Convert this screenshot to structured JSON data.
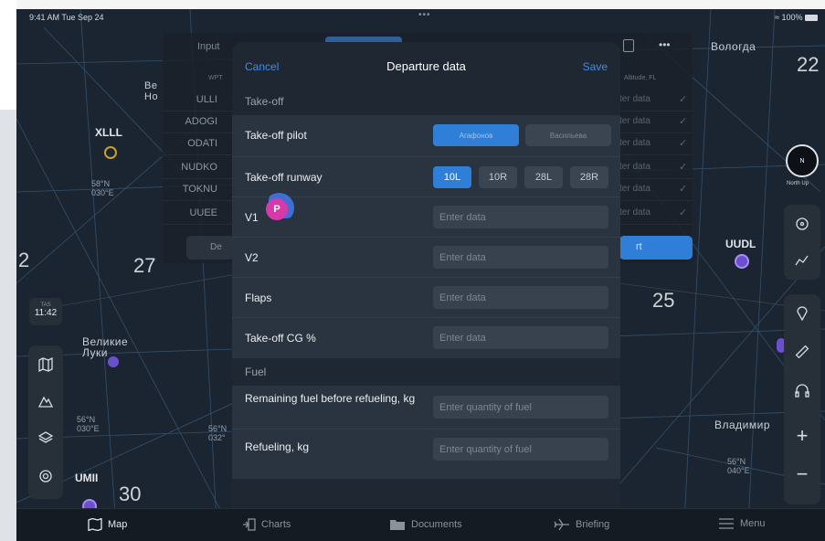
{
  "status_bar": {
    "time": "9:41 AM   Tue Sep 24",
    "battery": "100%",
    "dots": "•••"
  },
  "map": {
    "labels": [
      {
        "text": "Вологда"
      },
      {
        "text": "Великие Луки"
      },
      {
        "text": "Владимир"
      },
      {
        "text": "Be Но"
      }
    ],
    "codes": [
      "XLLL",
      "UUDL",
      "UMII"
    ],
    "coords": [
      {
        "text": "58°N 030°E"
      },
      {
        "text": "56°N 030°E"
      },
      {
        "text": "56°N 032°"
      },
      {
        "text": "56°N 040°E"
      }
    ],
    "big": [
      "27",
      "25",
      "30",
      "22",
      "2"
    ],
    "tas": {
      "label": "TAS",
      "value": "11:42"
    },
    "north_up": "North Up"
  },
  "bg_table": {
    "tab_input": "Input",
    "col_wpt": "WPT",
    "col_alt": "Altitude, FL",
    "wpts": [
      "ULLI",
      "ADOGI",
      "ODATI",
      "NUDKO",
      "TOKNU",
      "UUEE"
    ],
    "enter": "ter data",
    "export_fragment": "rt",
    "bottom_left": "De"
  },
  "modal": {
    "cancel": "Cancel",
    "title": "Departure data",
    "save": "Save",
    "sections": {
      "takeoff": "Take-off",
      "fuel": "Fuel"
    },
    "takeoff_pilot": {
      "label": "Take-off pilot",
      "options": [
        "Агафонов",
        "Васильева"
      ],
      "selected": 0
    },
    "takeoff_runway": {
      "label": "Take-off runway",
      "options": [
        "10L",
        "10R",
        "28L",
        "28R"
      ],
      "selected": 0
    },
    "fields": [
      {
        "label": "V1",
        "placeholder": "Enter data"
      },
      {
        "label": "V2",
        "placeholder": "Enter data"
      },
      {
        "label": "Flaps",
        "placeholder": "Enter data"
      },
      {
        "label": "Take-off CG %",
        "placeholder": "Enter data"
      }
    ],
    "fuel_fields": [
      {
        "label": "Remaining fuel before refueling, kg",
        "placeholder": "Enter quantity of fuel"
      },
      {
        "label": "Refueling, kg",
        "placeholder": "Enter quantity of fuel"
      }
    ]
  },
  "avatar_letter": "P",
  "tabbar": [
    {
      "label": "Map",
      "active": true
    },
    {
      "label": "Charts",
      "active": false
    },
    {
      "label": "Documents",
      "active": false
    },
    {
      "label": "Briefing",
      "active": false
    },
    {
      "label": "Menu",
      "active": false
    }
  ],
  "colors": {
    "accent": "#2f7fd8",
    "link": "#3f8ee6",
    "avatar": "#d63aa8"
  }
}
